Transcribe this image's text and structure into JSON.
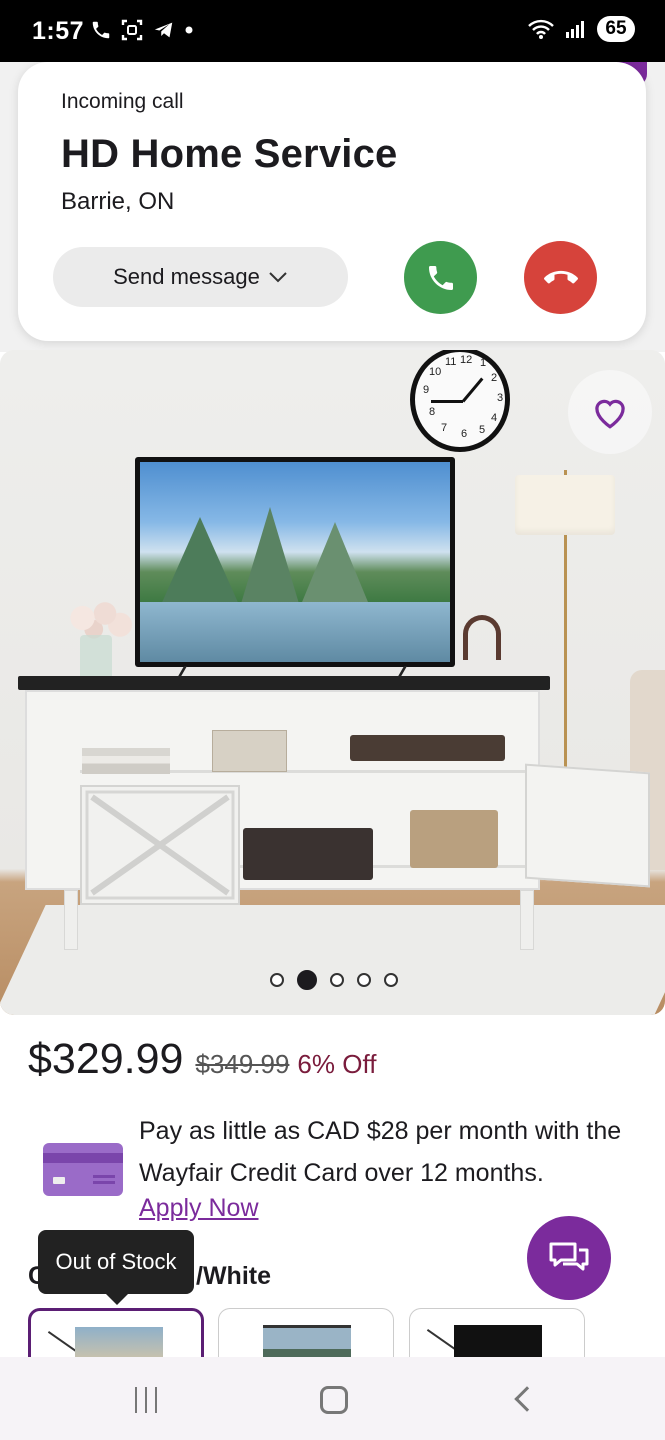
{
  "status_bar": {
    "time": "1:57",
    "battery": "65",
    "left_icons": [
      "phone-icon",
      "screenshot-icon",
      "telegram-icon",
      "dot-icon"
    ],
    "right_icons": [
      "wifi-icon",
      "signal-icon",
      "battery-icon"
    ]
  },
  "incoming_call": {
    "label": "Incoming call",
    "caller_name": "HD Home Service",
    "location": "Barrie, ON",
    "send_message_label": "Send message",
    "accept_color": "#3f9b4f",
    "decline_color": "#d6433b"
  },
  "product": {
    "image_dots": {
      "count": 5,
      "active_index": 1
    },
    "price": "$329.99",
    "original_price": "$349.99",
    "discount": "6% Off",
    "promo_text": "Pay as little as CAD $28 per month with the Wayfair Credit Card over 12 months.",
    "apply_link": "Apply Now",
    "option_value": "/White",
    "tooltip": "Out of Stock",
    "accent_color": "#7b2b9c",
    "clock_numbers": [
      "11",
      "12",
      "1",
      "10",
      "2",
      "9",
      "3",
      "8",
      "4",
      "7",
      "6",
      "5"
    ]
  },
  "nav_bar": {
    "icons": [
      "recent-apps-icon",
      "home-icon",
      "back-icon"
    ]
  }
}
